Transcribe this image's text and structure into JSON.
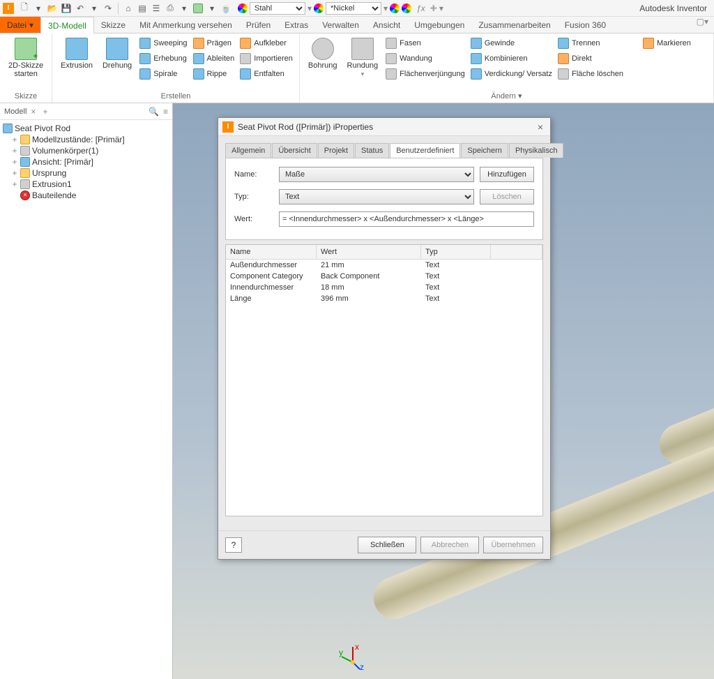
{
  "app": {
    "title": "Autodesk Inventor"
  },
  "materials": {
    "m1": "Stahl",
    "m2": "*Nickel"
  },
  "file_tab": "Datei",
  "tabs": [
    "3D-Modell",
    "Skizze",
    "Mit Anmerkung versehen",
    "Prüfen",
    "Extras",
    "Verwalten",
    "Ansicht",
    "Umgebungen",
    "Zusammenarbeiten",
    "Fusion 360"
  ],
  "ribbon": {
    "skizze": {
      "big": "2D-Skizze\nstarten",
      "label": "Skizze"
    },
    "erstellen": {
      "label": "Erstellen",
      "big1": "Extrusion",
      "big2": "Drehung",
      "items": [
        "Sweeping",
        "Prägen",
        "Aufkleber",
        "Erhebung",
        "Ableiten",
        "Importieren",
        "Spirale",
        "Rippe",
        "Entfalten"
      ]
    },
    "aendern": {
      "label": "Ändern ▾",
      "big1": "Bohrung",
      "big2": "Rundung",
      "items": [
        "Fasen",
        "Gewinde",
        "Trennen",
        "Wandung",
        "Kombinieren",
        "Direkt",
        "Flächenverjüngung",
        "Verdickung/ Versatz",
        "Fläche löschen"
      ],
      "mark": "Markieren"
    }
  },
  "model_panel": {
    "title": "Modell",
    "root": "Seat Pivot Rod",
    "items": [
      "Modellzustände: [Primär]",
      "Volumenkörper(1)",
      "Ansicht: [Primär]",
      "Ursprung",
      "Extrusion1",
      "Bauteilende"
    ]
  },
  "dialog": {
    "title": "Seat Pivot Rod ([Primär]) iProperties",
    "tabs": [
      "Allgemein",
      "Übersicht",
      "Projekt",
      "Status",
      "Benutzerdefiniert",
      "Speichern",
      "Physikalisch"
    ],
    "form": {
      "name_lbl": "Name:",
      "name_val": "Maße",
      "typ_lbl": "Typ:",
      "typ_val": "Text",
      "wert_lbl": "Wert:",
      "wert_val": "= <Innendurchmesser> x <Außendurchmesser> x <Länge>",
      "add": "Hinzufügen",
      "del": "Löschen"
    },
    "table": {
      "headers": [
        "Name",
        "Wert",
        "Typ"
      ],
      "rows": [
        {
          "n": "Außendurchmesser",
          "w": "21 mm",
          "t": "Text"
        },
        {
          "n": "Component Category",
          "w": "Back Component",
          "t": "Text"
        },
        {
          "n": "Innendurchmesser",
          "w": "18 mm",
          "t": "Text"
        },
        {
          "n": "Länge",
          "w": "396 mm",
          "t": "Text"
        }
      ]
    },
    "buttons": {
      "help": "?",
      "close": "Schließen",
      "cancel": "Abbrechen",
      "apply": "Übernehmen"
    }
  }
}
